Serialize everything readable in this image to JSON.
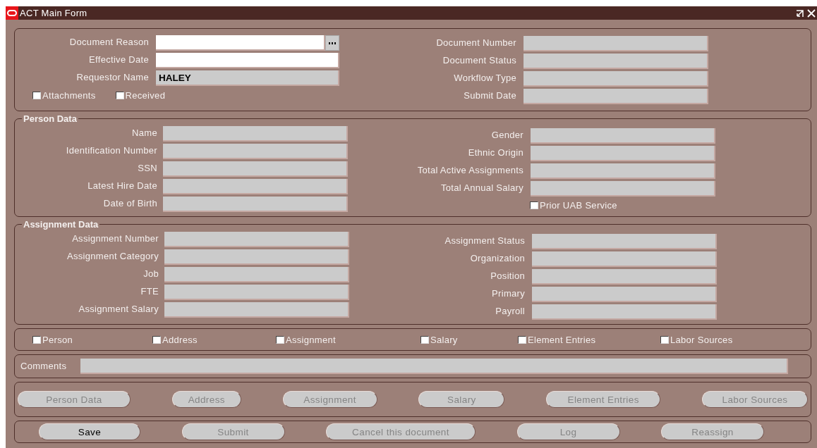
{
  "window": {
    "title": "ACT Main Form"
  },
  "header": {
    "left_fields": [
      {
        "label": "Document Reason",
        "disabled": false,
        "lov": true
      },
      {
        "label": "Effective Date",
        "disabled": false,
        "lov": false
      },
      {
        "label": "Requestor Name",
        "value": "HALEY",
        "disabled": true,
        "lov": false
      }
    ],
    "checkboxes": [
      {
        "label": "Attachments",
        "checked": false
      },
      {
        "label": "Received",
        "checked": false
      }
    ],
    "right_fields": [
      {
        "label": "Document Number",
        "disabled": true
      },
      {
        "label": "Document Status",
        "disabled": true
      },
      {
        "label": "Workflow Type",
        "disabled": true
      },
      {
        "label": "Submit Date",
        "disabled": true
      }
    ]
  },
  "person_data": {
    "title": "Person Data",
    "left_fields": [
      {
        "label": "Name",
        "disabled": true
      },
      {
        "label": "Identification Number",
        "disabled": true
      },
      {
        "label": "SSN",
        "disabled": true
      },
      {
        "label": "Latest Hire Date",
        "disabled": true
      },
      {
        "label": "Date of Birth",
        "disabled": true
      }
    ],
    "right_fields": [
      {
        "label": "Gender",
        "disabled": true
      },
      {
        "label": "Ethnic Origin",
        "disabled": true
      },
      {
        "label": "Total Active Assignments",
        "disabled": true
      },
      {
        "label": "Total Annual Salary",
        "disabled": true
      }
    ],
    "checkbox": {
      "label": "Prior UAB Service",
      "checked": false
    }
  },
  "assignment_data": {
    "title": "Assignment Data",
    "left_fields": [
      {
        "label": "Assignment Number",
        "disabled": true
      },
      {
        "label": "Assignment Category",
        "disabled": true
      },
      {
        "label": "Job",
        "disabled": true
      },
      {
        "label": "FTE",
        "disabled": true
      },
      {
        "label": "Assignment Salary",
        "disabled": true
      }
    ],
    "right_fields": [
      {
        "label": "Assignment Status",
        "disabled": true
      },
      {
        "label": "Organization",
        "disabled": true
      },
      {
        "label": "Position",
        "disabled": true
      },
      {
        "label": "Primary",
        "disabled": true
      },
      {
        "label": "Payroll",
        "disabled": true
      }
    ]
  },
  "change_checkboxes": [
    {
      "label": "Person",
      "checked": false
    },
    {
      "label": "Address",
      "checked": false
    },
    {
      "label": "Assignment",
      "checked": false
    },
    {
      "label": "Salary",
      "checked": false
    },
    {
      "label": "Element Entries",
      "checked": false
    },
    {
      "label": "Labor Sources",
      "checked": false
    }
  ],
  "comments": {
    "label": "Comments",
    "disabled": true
  },
  "nav_buttons": [
    {
      "label": "Person Data",
      "disabled": true
    },
    {
      "label": "Address",
      "disabled": true
    },
    {
      "label": "Assignment",
      "disabled": true
    },
    {
      "label": "Salary",
      "disabled": true
    },
    {
      "label": "Element Entries",
      "disabled": true
    },
    {
      "label": "Labor Sources",
      "disabled": true
    }
  ],
  "action_buttons": [
    {
      "label": "Save",
      "disabled": false
    },
    {
      "label": "Submit",
      "disabled": true
    },
    {
      "label": "Cancel this document",
      "disabled": true
    },
    {
      "label": "Log",
      "disabled": true
    },
    {
      "label": "Reassign",
      "disabled": true
    }
  ]
}
